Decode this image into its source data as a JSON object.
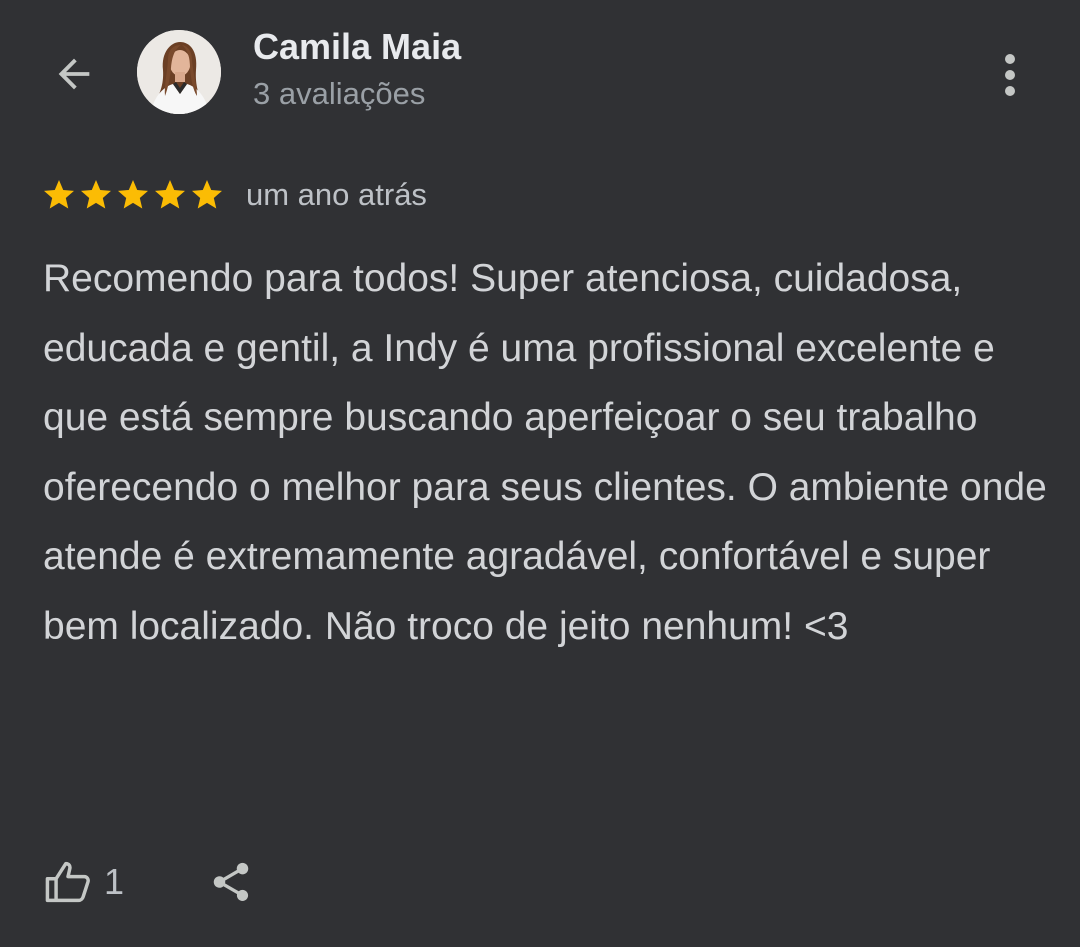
{
  "header": {
    "reviewer_name": "Camila Maia",
    "review_count": "3 avaliações",
    "back_icon": "arrow-back-icon",
    "more_icon": "more-vert-icon"
  },
  "review": {
    "rating": 5,
    "rating_max": 5,
    "time_ago": "um ano atrás",
    "text": "Recomendo para todos! Super atenciosa, cuidadosa, educada e gentil, a Indy é uma profissional excelente e que está sempre buscando aperfeiçoar o seu trabalho oferecendo o melhor para seus clientes. O ambiente onde atende é extremamente agradável, confortável e super bem localizado. Não troco de jeito nenhum! <3"
  },
  "actions": {
    "like_count": "1",
    "like_icon": "thumb-up-icon",
    "share_icon": "share-icon"
  },
  "colors": {
    "background": "#303134",
    "star": "#fbbc04",
    "primary_text": "#e8eaed",
    "secondary_text": "#9aa0a6"
  }
}
